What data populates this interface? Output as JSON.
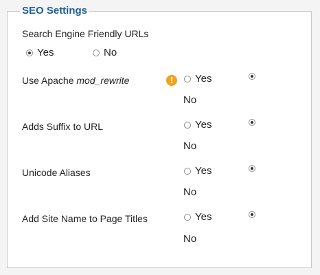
{
  "fieldset": {
    "legend": "SEO Settings"
  },
  "settings": [
    {
      "label": "Search Engine Friendly URLs",
      "yes": "Yes",
      "no": "No",
      "selected": "Yes"
    },
    {
      "label_prefix": "Use Apache ",
      "label_em": "mod_rewrite",
      "yes": "Yes",
      "no": "No",
      "selected": "No",
      "icon": "warning-icon",
      "icon_glyph": "!"
    },
    {
      "label": "Adds Suffix to URL",
      "yes": "Yes",
      "no": "No",
      "selected": "No"
    },
    {
      "label": "Unicode Aliases",
      "yes": "Yes",
      "no": "No",
      "selected": "No"
    },
    {
      "label": "Add Site Name to Page Titles",
      "yes": "Yes",
      "no": "No",
      "selected": "No"
    }
  ],
  "colors": {
    "legend": "#1f5f94",
    "warning": "#f2a21b",
    "border": "#c9c9c9"
  }
}
